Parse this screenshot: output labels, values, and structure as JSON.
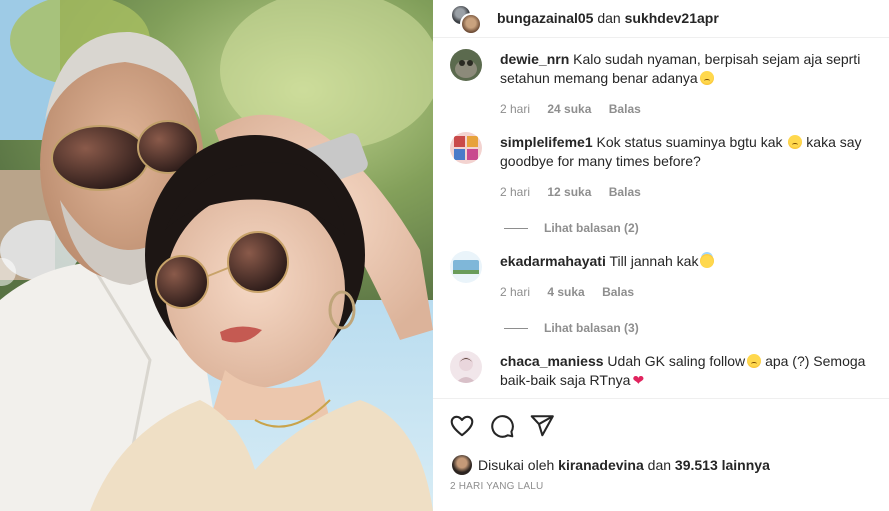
{
  "post": {
    "header": {
      "user_a": "bungazainal05",
      "separator": "dan",
      "user_b": "sukhdev21apr"
    }
  },
  "comments": [
    {
      "user": "dewie_nrn",
      "text": "Kalo sudah nyaman, berpisah sejam aja seprti setahun memang benar adanya",
      "emoji": "sad-face-icon",
      "time": "2 hari",
      "likes": "24 suka",
      "reply": "Balas",
      "avatar_color": "#5b6a4e"
    },
    {
      "user": "simplelifeme1",
      "text": "Kok status suaminya bgtu kak",
      "text_after_emoji": "kaka say goodbye for many times before?",
      "emoji": "sad-face-icon",
      "time": "2 hari",
      "likes": "12 suka",
      "reply": "Balas",
      "view_replies": "Lihat balasan (2)",
      "avatar_color": "#c94a4a"
    },
    {
      "user": "ekadarmahayati",
      "text": "Till jannah kak",
      "emoji": "angel-face-icon",
      "time": "2 hari",
      "likes": "4 suka",
      "reply": "Balas",
      "view_replies": "Lihat balasan (3)",
      "avatar_color": "#7fb7d9"
    },
    {
      "user": "chaca_maniess",
      "text": "Udah GK saling follow",
      "text_after_emoji": "apa (?) Semoga baik-baik saja RTnya",
      "emoji": "sad-face-icon",
      "emoji_end": "heart-icon",
      "emoji_end_glyph": "❤",
      "avatar_color": "#e9d6dc"
    }
  ],
  "actions": {
    "like_icon": "heart-outline-icon",
    "comment_icon": "comment-bubble-icon",
    "share_icon": "paper-plane-icon"
  },
  "likes": {
    "prefix": "Disukai oleh",
    "user": "kiranadevina",
    "connector": "dan",
    "count": "39.513 lainnya"
  },
  "timestamp": "2 HARI YANG LALU",
  "colors": {
    "text": "#262626",
    "muted": "#8e8e8e",
    "border": "#efefef",
    "heart": "#e0245e"
  }
}
